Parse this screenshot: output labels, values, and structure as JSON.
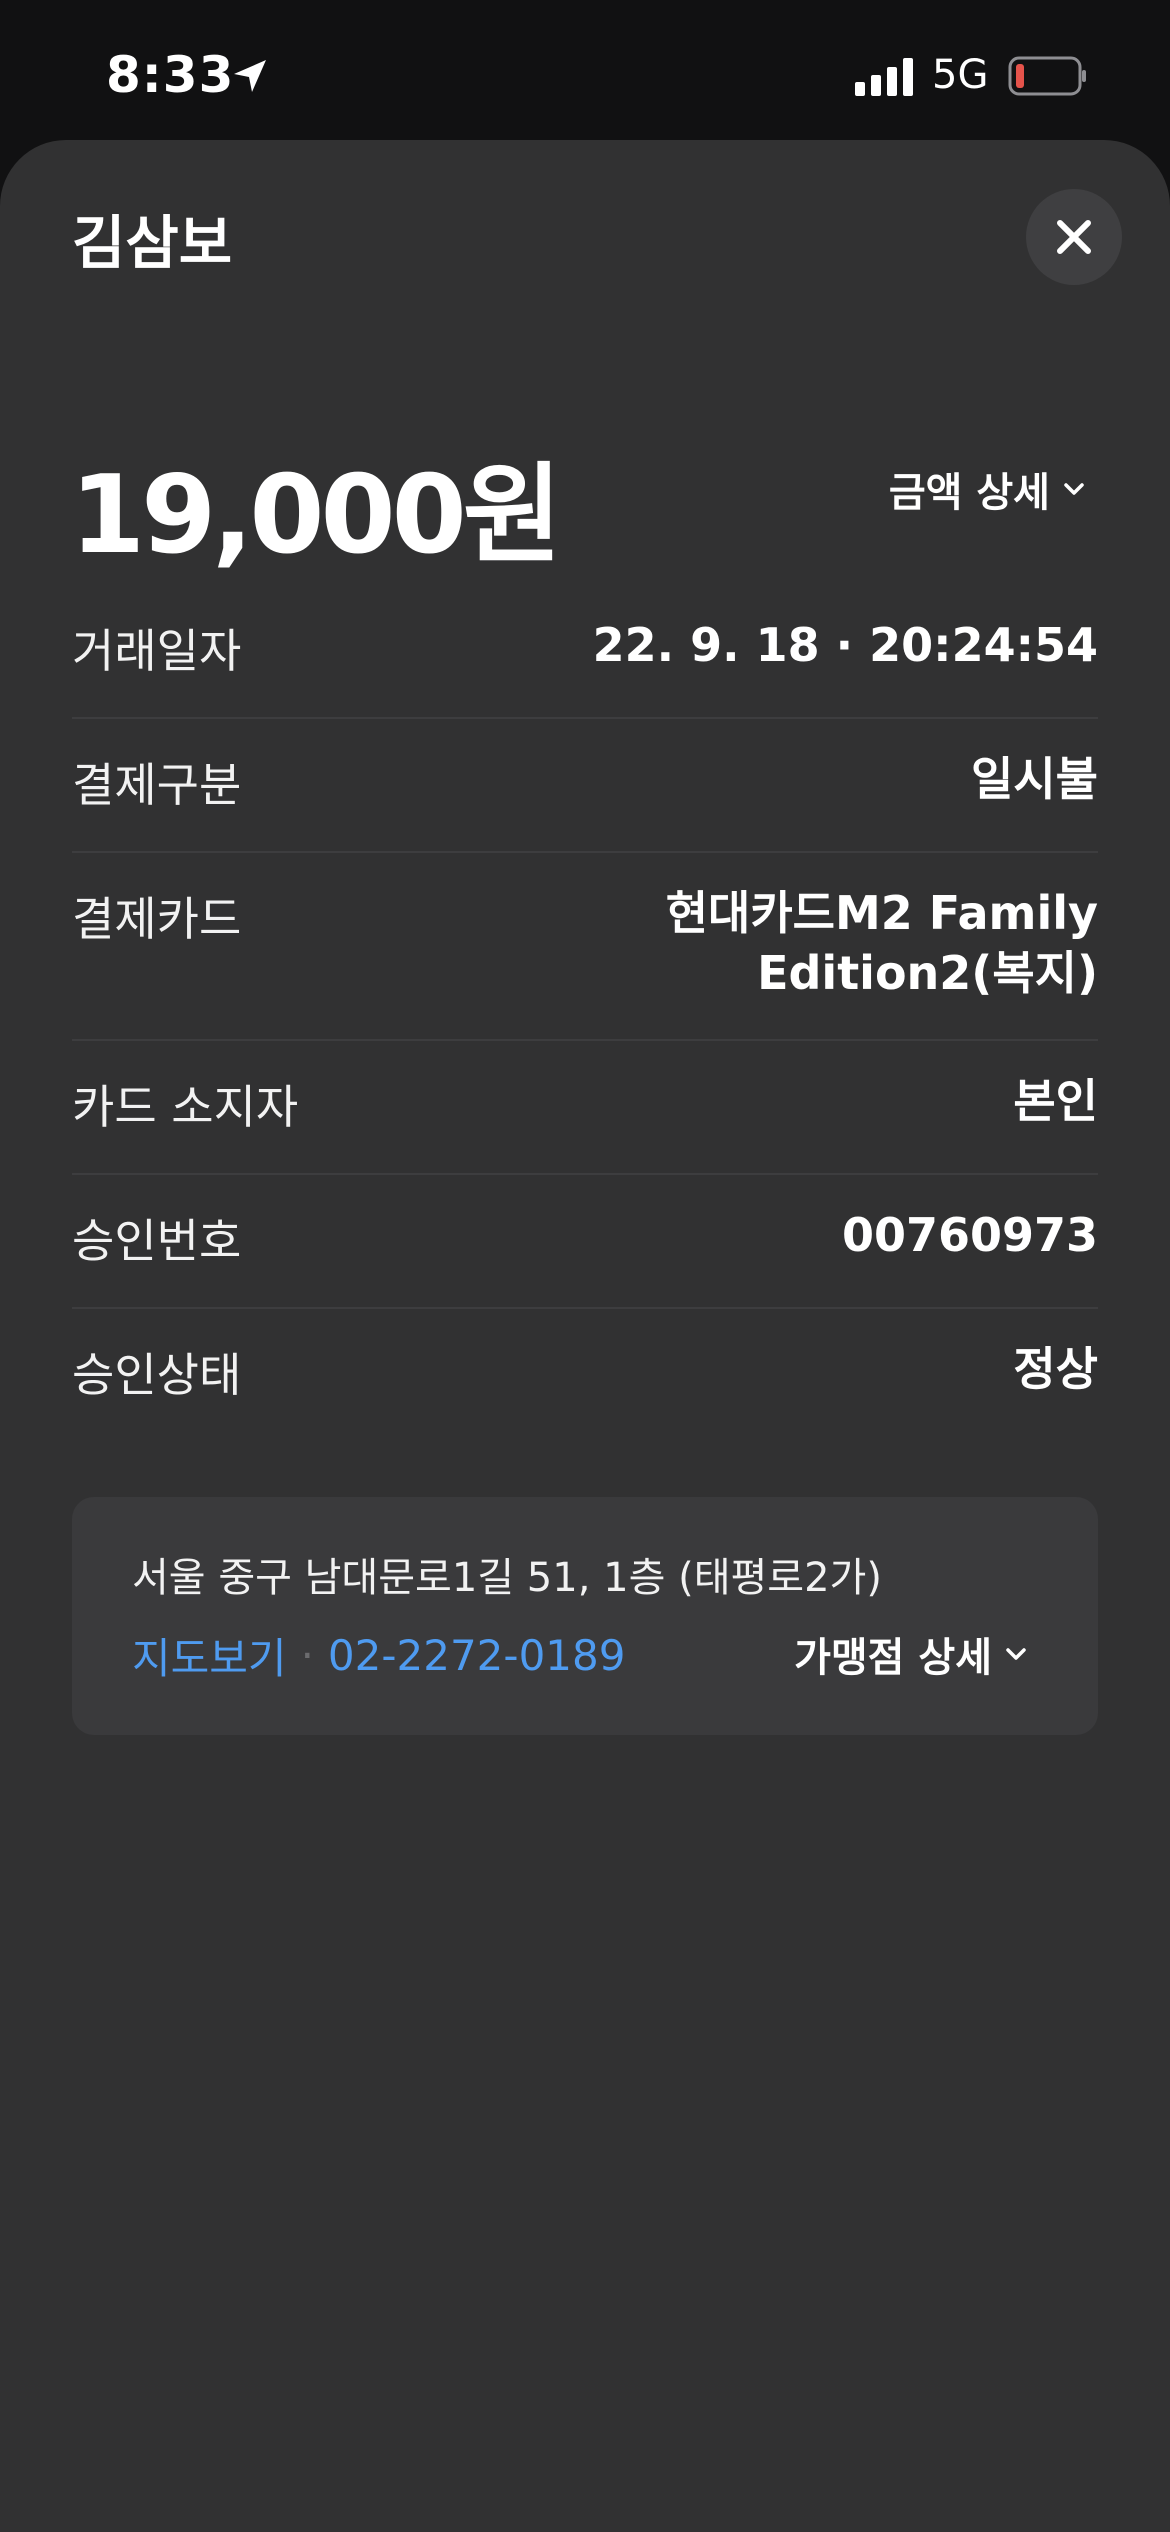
{
  "status": {
    "time": "8:33",
    "network": "5G"
  },
  "header": {
    "title": "김삼보"
  },
  "amount": {
    "value": "19,000원",
    "detail_label": "금액 상세"
  },
  "rows": [
    {
      "label": "거래일자",
      "value": "22. 9. 18 · 20:24:54"
    },
    {
      "label": "결제구분",
      "value": "일시불"
    },
    {
      "label": "결제카드",
      "value": "현대카드M2 Family Edition2(복지)"
    },
    {
      "label": "카드 소지자",
      "value": "본인"
    },
    {
      "label": "승인번호",
      "value": "00760973"
    },
    {
      "label": "승인상태",
      "value": "정상"
    }
  ],
  "merchant": {
    "address": "서울 중구 남대문로1길 51, 1층 (태평로2가)",
    "map_link": "지도보기",
    "phone": "02-2272-0189",
    "detail_label": "가맹점 상세"
  },
  "colors": {
    "sheet_bg": "#313132",
    "link": "#4f9bf0",
    "battery_low": "#e5534b"
  }
}
